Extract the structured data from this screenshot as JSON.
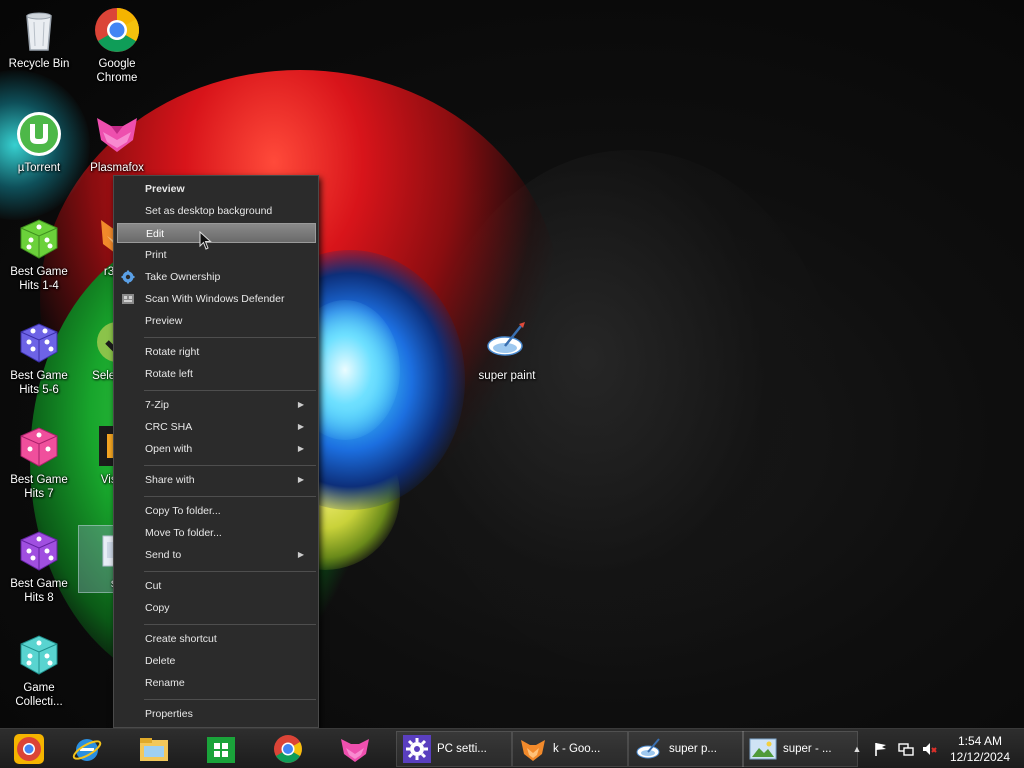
{
  "desktop": {
    "icons": [
      {
        "label": "Recycle Bin",
        "icon": "recycle-bin-icon"
      },
      {
        "label": "Google Chrome",
        "icon": "chrome-icon"
      },
      {
        "label": "µTorrent",
        "icon": "utorrent-icon"
      },
      {
        "label": "Plasmafox",
        "icon": "plasmafox-icon"
      },
      {
        "label": "Best Game Hits 1-4",
        "icon": "green-dice-icon"
      },
      {
        "label": "r3dfo",
        "icon": "r3dfox-icon"
      },
      {
        "label": "Best Game Hits 5-6",
        "icon": "blue-dice-icon"
      },
      {
        "label": "Sele Web",
        "icon": "selenium-icon"
      },
      {
        "label": "Best Game Hits 7",
        "icon": "pink-dice-icon"
      },
      {
        "label": "Visi St",
        "icon": "visual-studio-icon"
      },
      {
        "label": "Best Game Hits 8",
        "icon": "purple-dice-icon"
      },
      {
        "label": "su",
        "icon": "image-file-icon"
      },
      {
        "label": "Game Collecti...",
        "icon": "teal-dice-icon"
      },
      {
        "label": "super paint",
        "icon": "super-paint-icon"
      }
    ]
  },
  "context_menu": {
    "items": [
      {
        "label": "Preview",
        "bold": true
      },
      {
        "label": "Set as desktop background"
      },
      {
        "label": "Edit",
        "highlighted": true
      },
      {
        "label": "Print"
      },
      {
        "label": "Take Ownership",
        "icon": "gear-icon"
      },
      {
        "label": "Scan With Windows Defender",
        "icon": "defender-icon"
      },
      {
        "label": "Preview"
      },
      {
        "label": "Rotate right"
      },
      {
        "label": "Rotate left"
      },
      {
        "label": "7-Zip",
        "submenu": true
      },
      {
        "label": "CRC SHA",
        "submenu": true
      },
      {
        "label": "Open with",
        "submenu": true
      },
      {
        "label": "Share with",
        "submenu": true
      },
      {
        "label": "Copy To folder..."
      },
      {
        "label": "Move To folder..."
      },
      {
        "label": "Send to",
        "submenu": true
      },
      {
        "label": "Cut"
      },
      {
        "label": "Copy"
      },
      {
        "label": "Create shortcut"
      },
      {
        "label": "Delete"
      },
      {
        "label": "Rename"
      },
      {
        "label": "Properties"
      }
    ],
    "submenu_arrow": "▶"
  },
  "taskbar": {
    "pinned": [
      "chrome-canary-icon",
      "internet-explorer-icon",
      "file-explorer-icon",
      "store-icon",
      "chrome-icon",
      "plasmafox-icon"
    ],
    "windows": [
      {
        "label": "PC setti...",
        "icon": "settings-gear-icon"
      },
      {
        "label": "k - Goo...",
        "icon": "r3dfox-icon"
      },
      {
        "label": "super p...",
        "icon": "super-paint-icon"
      },
      {
        "label": "super - ...",
        "icon": "photo-viewer-icon"
      }
    ],
    "tray": {
      "show_hidden": "▲",
      "icons": [
        "flag-icon",
        "network-icon",
        "volume-muted-icon"
      ]
    },
    "clock": {
      "time": "1:54 AM",
      "date": "12/12/2024"
    }
  },
  "colors": {
    "menu_bg": "#2b2b2b",
    "menu_highlight": "#7a7a7a",
    "taskbar": "#222222"
  }
}
